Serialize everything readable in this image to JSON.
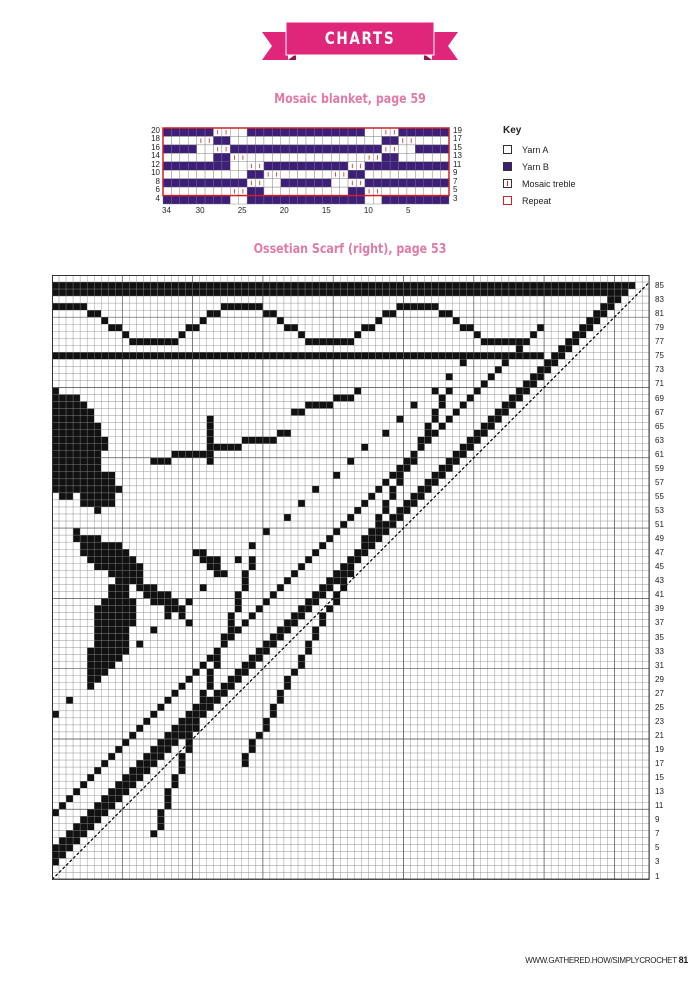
{
  "header": {
    "banner": "CHARTS",
    "banner_color": "#e0267a"
  },
  "mosaic": {
    "title": "Mosaic blanket, page 59",
    "left_labels": [
      "20",
      "18",
      "16",
      "14",
      "12",
      "10",
      "8",
      "6",
      "4"
    ],
    "right_labels": [
      "19",
      "17",
      "15",
      "13",
      "11",
      "9",
      "7",
      "5",
      "3"
    ],
    "bottom_labels": [
      "34",
      "30",
      "25",
      "20",
      "15",
      "10",
      "5"
    ],
    "rows": [
      "BBBBBBMMAABBBBBBBBBBBBBBAAMMBBBBBB",
      "AAAAMMBBAAAAAAAAAAAAAAAAAABBMMAAAA",
      "BBBBAAMMBBBBBBBBBBBBBBBBBBMMAABBBB",
      "AAAAAABBMMAAAAAAAAAAAAAAMMBBAAAAAA",
      "BBBBBBBBAAMMBBBBBBBBBBMMBBBBBBBBBB",
      "AAAAAAAAAABBMMAAAAAAMMBBAAAAAAAAAA",
      "BBBBBBBBBBMMAABBBBBBAAMMBBBBBBBBBB",
      "AAAAAAAAMMBBAAAAAAAAAABBMMAAAAAAAA",
      "BBBBBBBBAABBBBBBBBBBBBBBAABBBBBBBB"
    ],
    "colors": {
      "yarn_a": "#ffffff",
      "yarn_b": "#3d1f7a",
      "mosaic_mark": "#d0202a",
      "repeat": "#d0202a"
    },
    "key": {
      "title": "Key",
      "items": [
        {
          "label": "Yarn A",
          "type": "yarn_a"
        },
        {
          "label": "Yarn B",
          "type": "yarn_b"
        },
        {
          "label": "Mosaic treble",
          "type": "mosaic"
        },
        {
          "label": "Repeat",
          "type": "repeat"
        }
      ]
    }
  },
  "ossetian": {
    "title": "Ossetian Scarf (right), page 53",
    "row_labels": [
      "85",
      "83",
      "81",
      "79",
      "77",
      "75",
      "73",
      "71",
      "69",
      "67",
      "65",
      "63",
      "61",
      "59",
      "57",
      "55",
      "53",
      "51",
      "49",
      "47",
      "45",
      "43",
      "41",
      "39",
      "37",
      "35",
      "33",
      "31",
      "29",
      "27",
      "25",
      "23",
      "21",
      "19",
      "17",
      "15",
      "13",
      "11",
      "9",
      "7",
      "5",
      "3",
      "1"
    ]
  },
  "footer": {
    "url": "WWW.GATHERED.HOW/SIMPLYCROCHET",
    "page": "81"
  }
}
